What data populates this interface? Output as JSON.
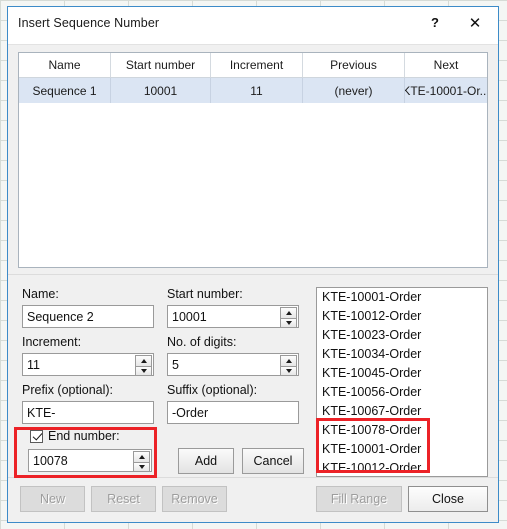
{
  "window": {
    "title": "Insert Sequence Number",
    "help_icon": "question-mark-icon",
    "close_icon": "close-icon",
    "help_label": "?",
    "close_label": "✕"
  },
  "table": {
    "columns": [
      "Name",
      "Start number",
      "Increment",
      "Previous",
      "Next"
    ],
    "rows": [
      {
        "name": "Sequence 1",
        "start_number": "10001",
        "increment": "11",
        "previous": "(never)",
        "next": "KTE-10001-Or...",
        "selected": true
      }
    ]
  },
  "form": {
    "name_label": "Name:",
    "name_value": "Sequence 2",
    "start_number_label": "Start number:",
    "start_number_value": "10001",
    "increment_label": "Increment:",
    "increment_value": "11",
    "digits_label": "No. of digits:",
    "digits_value": "5",
    "prefix_label": "Prefix (optional):",
    "prefix_value": "KTE-",
    "suffix_label": "Suffix (optional):",
    "suffix_value": "-Order",
    "end_number_label": "End number:",
    "end_number_checked": true,
    "end_number_value": "10078",
    "add_label": "Add",
    "cancel_label": "Cancel"
  },
  "preview": {
    "items": [
      "KTE-10001-Order",
      "KTE-10012-Order",
      "KTE-10023-Order",
      "KTE-10034-Order",
      "KTE-10045-Order",
      "KTE-10056-Order",
      "KTE-10067-Order",
      "KTE-10078-Order",
      "KTE-10001-Order",
      "KTE-10012-Order"
    ]
  },
  "footer": {
    "new_label": "New",
    "reset_label": "Reset",
    "remove_label": "Remove",
    "fill_range_label": "Fill Range",
    "close_label": "Close"
  },
  "colors": {
    "window_border": "#3d8bc8",
    "selection_row": "#dbe5f3",
    "annotation_red": "#ec2227",
    "panel_bg": "#f0f0f0"
  }
}
